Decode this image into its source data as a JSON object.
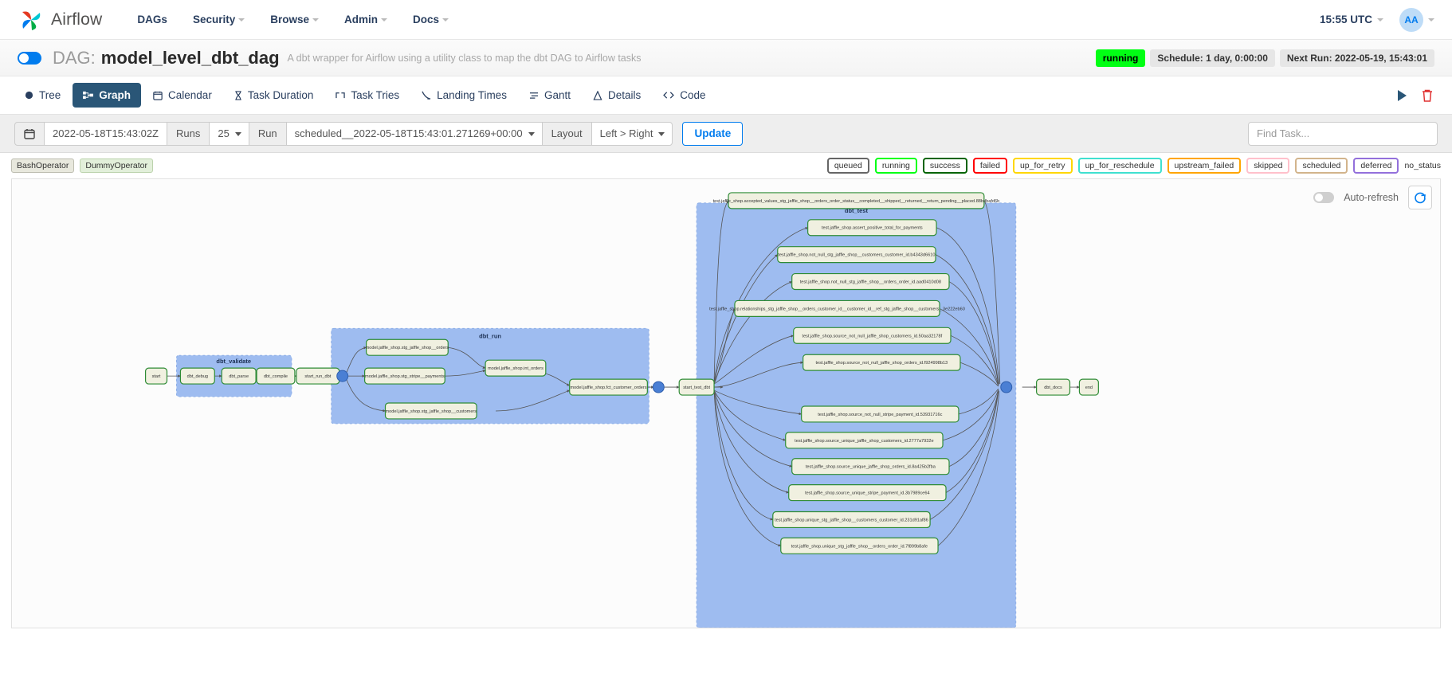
{
  "navbar": {
    "brand": "Airflow",
    "brand_logo_icon": "airflow-pinwheel-logo",
    "links": [
      {
        "label": "DAGs",
        "has_caret": false
      },
      {
        "label": "Security",
        "has_caret": true
      },
      {
        "label": "Browse",
        "has_caret": true
      },
      {
        "label": "Admin",
        "has_caret": true
      },
      {
        "label": "Docs",
        "has_caret": true
      }
    ],
    "clock": "15:55 UTC",
    "avatar_initials": "AA"
  },
  "dag_header": {
    "title_prefix": "DAG:",
    "title": "model_level_dbt_dag",
    "description": "A dbt wrapper for Airflow using a utility class to map the dbt DAG to Airflow tasks",
    "status": "running",
    "schedule": "Schedule: 1 day, 0:00:00",
    "next_run": "Next Run: 2022-05-19, 15:43:01"
  },
  "tabs": [
    {
      "label": "Tree",
      "icon": "tree-icon",
      "active": false
    },
    {
      "label": "Graph",
      "icon": "graph-icon",
      "active": true
    },
    {
      "label": "Calendar",
      "icon": "calendar-icon",
      "active": false
    },
    {
      "label": "Task Duration",
      "icon": "hourglass-icon",
      "active": false
    },
    {
      "label": "Task Tries",
      "icon": "task-tries-icon",
      "active": false
    },
    {
      "label": "Landing Times",
      "icon": "landing-times-icon",
      "active": false
    },
    {
      "label": "Gantt",
      "icon": "gantt-icon",
      "active": false
    },
    {
      "label": "Details",
      "icon": "details-icon",
      "active": false
    },
    {
      "label": "Code",
      "icon": "code-icon",
      "active": false
    }
  ],
  "tabs_right": [
    {
      "icon": "trigger-dag-play-icon",
      "color": "#2a5677"
    },
    {
      "icon": "delete-dag-trash-icon",
      "color": "#e03232"
    }
  ],
  "controls": {
    "calendar_icon": "calendar-icon",
    "base_date_value": "2022-05-18T15:43:02Z",
    "runs_label": "Runs",
    "runs_value": "25",
    "run_label": "Run",
    "run_value": "scheduled__2022-05-18T15:43:01.271269+00:00",
    "layout_label": "Layout",
    "layout_value": "Left > Right",
    "update_label": "Update",
    "find_task_placeholder": "Find Task..."
  },
  "operators": [
    {
      "label": "BashOperator",
      "style": "bash"
    },
    {
      "label": "DummyOperator",
      "style": "dummy"
    }
  ],
  "status_legend": [
    {
      "label": "queued",
      "color": "#666666"
    },
    {
      "label": "running",
      "color": "#01ff14"
    },
    {
      "label": "success",
      "color": "#006400"
    },
    {
      "label": "failed",
      "color": "#ff0000"
    },
    {
      "label": "up_for_retry",
      "color": "#ffd700"
    },
    {
      "label": "up_for_reschedule",
      "color": "#40e0d0"
    },
    {
      "label": "upstream_failed",
      "color": "#ffa500"
    },
    {
      "label": "skipped",
      "color": "#ffc0cb"
    },
    {
      "label": "scheduled",
      "color": "#d2b48c"
    },
    {
      "label": "deferred",
      "color": "#9370db"
    },
    {
      "label": "no_status",
      "color": "#ffffff"
    }
  ],
  "graph_toolbar": {
    "auto_refresh_label": "Auto-refresh",
    "auto_refresh_on": false,
    "refresh_icon": "refresh-icon"
  },
  "graph": {
    "clusters": [
      {
        "name": "dbt_validate",
        "label": "dbt_validate"
      },
      {
        "name": "dbt_run",
        "label": "dbt_run"
      },
      {
        "name": "dbt_test",
        "label": "dbt_test"
      }
    ],
    "nodes": {
      "start": "start",
      "dbt_debug": "dbt_debug",
      "dbt_parse": "dbt_parse",
      "dbt_compile": "dbt_compile",
      "start_run_dbt": "start_run_dbt",
      "model_stg_jaffle_shop_orders": "model.jaffle_shop.stg_jaffle_shop__orders",
      "model_stg_stripe_payments": "model.jaffle_shop.stg_stripe__payments",
      "model_stg_jaffle_shop_customers": "model.jaffle_shop.stg_jaffle_shop__customers",
      "model_int_orders": "model.jaffle_shop.int_orders",
      "model_fct_customer_orders": "model.jaffle_shop.fct_customer_orders",
      "start_test_dbt": "start_test_dbt",
      "dbt_docs": "dbt_docs",
      "end": "end"
    },
    "test_nodes": [
      "test.jaffle_shop.accepted_values_stg_jaffle_shop__orders_order_status__completed__shipped__returned__return_pending__placed.88bdbafd6b",
      "test.jaffle_shop.assert_positive_total_for_payments",
      "test.jaffle_shop.not_null_stg_jaffle_shop__customers_customer_id.b4343d6610",
      "test.jaffle_shop.not_null_stg_jaffle_shop__orders_order_id.aad0410d08",
      "test.jaffle_shop.relationships_stg_jaffle_shop__orders_customer_id__customer_id__ref_stg_jaffle_shop__customers_.3e222eb60",
      "test.jaffle_shop.source_not_null_jaffle_shop_customers_id.50aa32178f",
      "test.jaffle_shop.source_not_null_jaffle_shop_orders_id.f924998b13",
      "test.jaffle_shop.source_not_null_stripe_payment_id.53931716c",
      "test.jaffle_shop.source_unique_jaffle_shop_customers_id.2777a7932e",
      "test.jaffle_shop.source_unique_jaffle_shop_orders_id.8a425b2fba",
      "test.jaffle_shop.source_unique_stripe_payment_id.3b7989ce64",
      "test.jaffle_shop.unique_stg_jaffle_shop__customers_customer_id.231d91af86",
      "test.jaffle_shop.unique_stg_jaffle_shop__orders_order_id.7f899b8afe"
    ]
  }
}
